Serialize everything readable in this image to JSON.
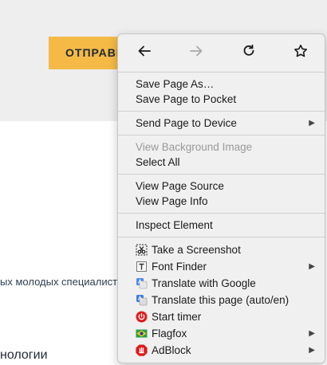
{
  "page": {
    "send_button_label": "ОТПРАВИТЬ",
    "body_text": "ых молодых специалистов",
    "section_heading": "нологии"
  },
  "context_menu": {
    "nav": {
      "back_icon": "arrow-left-icon",
      "forward_icon": "arrow-right-icon",
      "reload_icon": "reload-icon",
      "bookmark_icon": "star-icon"
    },
    "groups": {
      "save_page_as": "Save Page As…",
      "save_to_pocket": "Save Page to Pocket",
      "send_to_device": "Send Page to Device",
      "view_background_image": "View Background Image",
      "select_all": "Select All",
      "view_page_source": "View Page Source",
      "view_page_info": "View Page Info",
      "inspect_element": "Inspect Element",
      "take_screenshot": "Take a Screenshot",
      "font_finder": "Font Finder",
      "translate_google": "Translate with Google",
      "translate_page": "Translate this page (auto/en)",
      "start_timer": "Start timer",
      "flagfox": "Flagfox",
      "adblock": "AdBlock"
    },
    "submenu_arrow": "▶"
  },
  "colors": {
    "button_yellow": "#f5b945",
    "menu_background": "#f0f0f0",
    "disabled_text": "#9a9a9a"
  }
}
